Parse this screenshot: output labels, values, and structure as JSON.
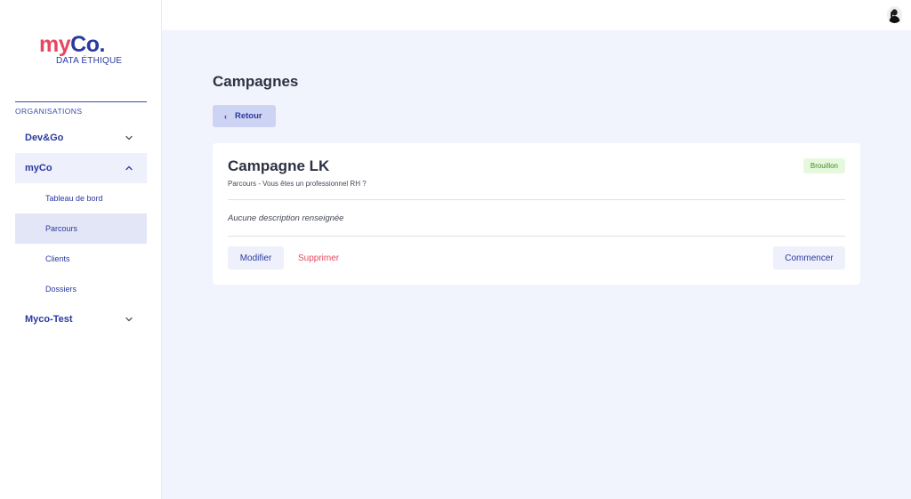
{
  "brand": {
    "logo_my": "my",
    "logo_co": "Co.",
    "logo_sub": "DATA ÉTHIQUE"
  },
  "sidebar": {
    "section_title": "ORGANISATIONS",
    "orgs": [
      {
        "label": "Dev&Go",
        "expanded": false,
        "icon": "chevron-down-icon"
      },
      {
        "label": "myCo",
        "expanded": true,
        "icon": "chevron-up-icon",
        "items": [
          {
            "label": "Tableau de bord"
          },
          {
            "label": "Parcours",
            "selected": true
          },
          {
            "label": "Clients"
          },
          {
            "label": "Dossiers"
          }
        ]
      },
      {
        "label": "Myco-Test",
        "expanded": false,
        "icon": "chevron-down-icon"
      }
    ]
  },
  "header": {
    "avatar_icon": "user-avatar"
  },
  "main": {
    "title": "Campagnes",
    "back_label": "Retour",
    "campaign": {
      "name": "Campagne LK",
      "subtitle": "Parcours - Vous êtes un professionnel RH ?",
      "status": "Brouillon",
      "description": "Aucune description renseignée",
      "modify_label": "Modifier",
      "delete_label": "Supprimer",
      "start_label": "Commencer"
    }
  },
  "colors": {
    "accent": "#2b3aa0",
    "danger": "#e8475f",
    "badge_bg": "#e7f9dd",
    "badge_text": "#3e8a2b",
    "background": "#f1f4fd"
  }
}
